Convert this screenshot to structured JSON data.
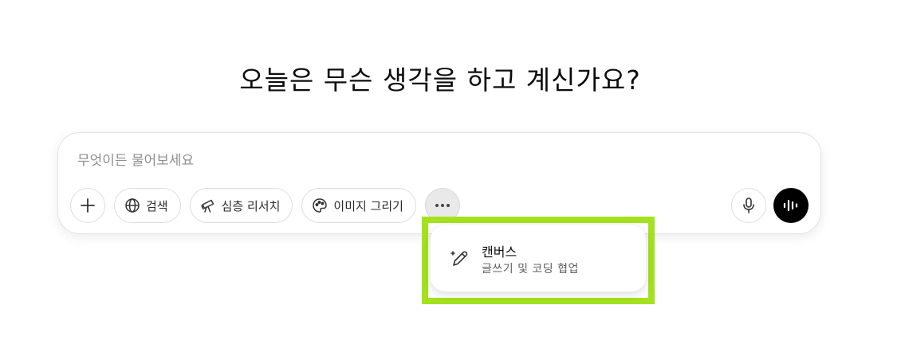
{
  "headline": "오늘은 무슨 생각을 하고 계신가요?",
  "composer": {
    "placeholder": "무엇이든 물어보세요",
    "value": ""
  },
  "tools": {
    "add_icon": "plus-icon",
    "search": {
      "label": "검색",
      "icon": "globe-icon"
    },
    "deep_research": {
      "label": "심층 리서치",
      "icon": "telescope-icon"
    },
    "image": {
      "label": "이미지 그리기",
      "icon": "palette-icon"
    },
    "more_icon": "more-horizontal-icon",
    "mic_icon": "microphone-icon",
    "voice_icon": "voice-waveform-icon"
  },
  "menu": {
    "items": [
      {
        "title": "캔버스",
        "subtitle": "글쓰기 및 코딩 협업",
        "icon": "pencil-sparkle-icon"
      }
    ]
  },
  "colors": {
    "highlight": "#a4e11f",
    "voice_button": "#000000",
    "more_button_active": "#e9e9e9"
  }
}
